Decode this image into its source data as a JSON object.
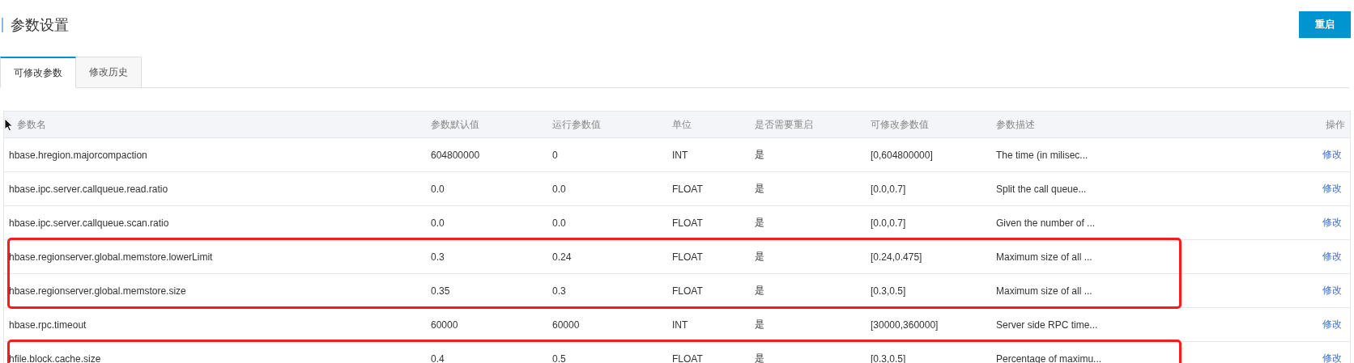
{
  "page": {
    "title": "参数设置",
    "restart_button": "重启"
  },
  "tabs": [
    {
      "label": "可修改参数",
      "selected": true
    },
    {
      "label": "修改历史",
      "selected": false
    }
  ],
  "table": {
    "columns": [
      "参数名",
      "参数默认值",
      "运行参数值",
      "单位",
      "是否需要重启",
      "可修改参数值",
      "参数描述",
      "操作"
    ],
    "rows": [
      {
        "cells": [
          "hbase.hregion.majorcompaction",
          "604800000",
          "0",
          "INT",
          "是",
          "[0,604800000]",
          "The time (in milisec..."
        ],
        "action": "修改",
        "outlined": false
      },
      {
        "cells": [
          "hbase.ipc.server.callqueue.read.ratio",
          "0.0",
          "0.0",
          "FLOAT",
          "是",
          "[0.0,0.7]",
          "Split the call queue..."
        ],
        "action": "修改",
        "outlined": false
      },
      {
        "cells": [
          "hbase.ipc.server.callqueue.scan.ratio",
          "0.0",
          "0.0",
          "FLOAT",
          "是",
          "[0.0,0.7]",
          "Given the number of ..."
        ],
        "action": "修改",
        "outlined": false
      },
      {
        "cells": [
          "hbase.regionserver.global.memstore.lowerLimit",
          "0.3",
          "0.24",
          "FLOAT",
          "是",
          "[0.24,0.475]",
          "Maximum size of all ..."
        ],
        "action": "修改",
        "outlined": true
      },
      {
        "cells": [
          "hbase.regionserver.global.memstore.size",
          "0.35",
          "0.3",
          "FLOAT",
          "是",
          "[0.3,0.5]",
          "Maximum size of all ..."
        ],
        "action": "修改",
        "outlined": true
      },
      {
        "cells": [
          "hbase.rpc.timeout",
          "60000",
          "60000",
          "INT",
          "是",
          "[30000,360000]",
          "Server side RPC time..."
        ],
        "action": "修改",
        "outlined": false
      },
      {
        "cells": [
          "hfile.block.cache.size",
          "0.4",
          "0.5",
          "FLOAT",
          "是",
          "[0.3,0.5]",
          "Percentage of maximu..."
        ],
        "action": "修改",
        "outlined": true
      }
    ]
  }
}
